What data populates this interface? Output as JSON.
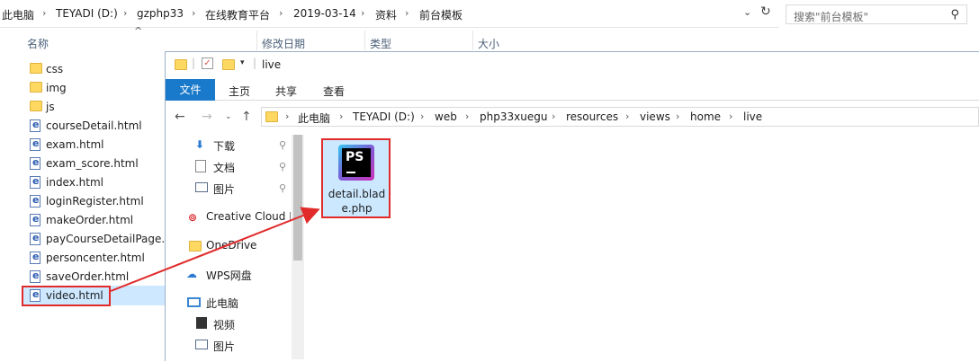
{
  "back_window": {
    "breadcrumb": [
      "此电脑",
      "TEYADI (D:)",
      "gzphp33",
      "在线教育平台",
      "2019-03-14",
      "资料",
      "前台模板"
    ],
    "search_placeholder": "搜索\"前台模板\"",
    "columns": [
      "名称",
      "修改日期",
      "类型",
      "大小"
    ],
    "files": [
      {
        "name": "css",
        "kind": "folder"
      },
      {
        "name": "img",
        "kind": "folder"
      },
      {
        "name": "js",
        "kind": "folder"
      },
      {
        "name": "courseDetail.html",
        "kind": "html"
      },
      {
        "name": "exam.html",
        "kind": "html"
      },
      {
        "name": "exam_score.html",
        "kind": "html"
      },
      {
        "name": "index.html",
        "kind": "html"
      },
      {
        "name": "loginRegister.html",
        "kind": "html"
      },
      {
        "name": "makeOrder.html",
        "kind": "html"
      },
      {
        "name": "payCourseDetailPage.h",
        "kind": "html"
      },
      {
        "name": "personcenter.html",
        "kind": "html"
      },
      {
        "name": "saveOrder.html",
        "kind": "html"
      },
      {
        "name": "video.html",
        "kind": "html"
      }
    ],
    "selected": "video.html"
  },
  "front_window": {
    "title": "live",
    "ribbon_tabs": [
      "文件",
      "主页",
      "共享",
      "查看"
    ],
    "breadcrumb": [
      "此电脑",
      "TEYADI (D:)",
      "web",
      "php33xuegu",
      "resources",
      "views",
      "home",
      "live"
    ],
    "quick_access": [
      "下载",
      "文档",
      "图片"
    ],
    "nav_items": [
      "Creative Cloud F",
      "OneDrive",
      "WPS网盘",
      "此电脑",
      "视频",
      "图片"
    ],
    "file": {
      "name": "detail.blade.php",
      "icon_text": "PS"
    }
  },
  "colors": {
    "accent": "#1979ca",
    "highlight": "#e12a2a",
    "selection": "#cde8ff"
  }
}
